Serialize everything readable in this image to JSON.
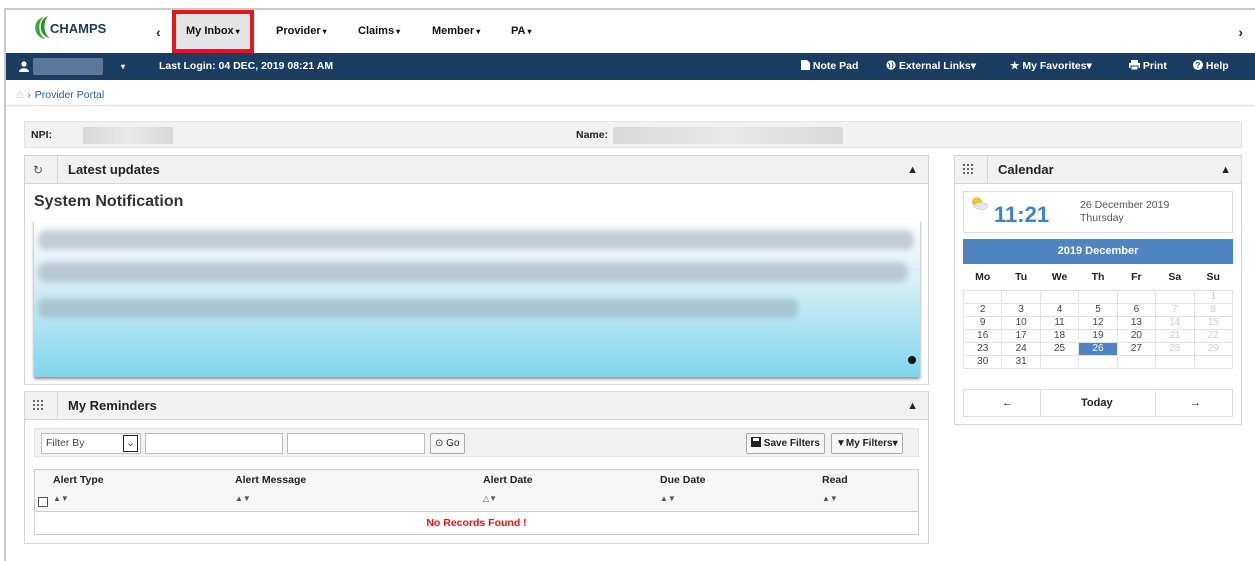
{
  "nav": {
    "logo_text": "CHAMPS",
    "left_arrow": "‹",
    "right_arrow": "›",
    "items": [
      {
        "label": "My Inbox",
        "caret": "▾"
      },
      {
        "label": "Provider",
        "caret": "▾"
      },
      {
        "label": "Claims",
        "caret": "▾"
      },
      {
        "label": "Member",
        "caret": "▾"
      },
      {
        "label": "PA",
        "caret": "▾"
      }
    ]
  },
  "toolbar": {
    "last_login": "Last Login: 04 DEC, 2019 08:21 AM",
    "note_pad": "Note Pad",
    "external_links": "External Links",
    "my_favorites": "My Favorites",
    "print": "Print",
    "help": "Help",
    "caret": "▾"
  },
  "breadcrumb": {
    "current": "Provider Portal"
  },
  "info": {
    "npi_label": "NPI:",
    "name_label": "Name:"
  },
  "updates": {
    "title": "Latest updates",
    "notification_title": "System Notification"
  },
  "reminders": {
    "title": "My Reminders",
    "filter_placeholder": "Filter By",
    "go_label": "Go",
    "save_filters": "Save Filters",
    "my_filters": "My Filters",
    "columns": [
      "Alert Type",
      "Alert Message",
      "Alert Date",
      "Due Date",
      "Read"
    ],
    "sort_glyph": "▲▼",
    "sort_glyph_alt": "△▼",
    "no_records": "No Records Found !"
  },
  "calendar": {
    "title": "Calendar",
    "time": "11:21",
    "date": "26 December 2019",
    "weekday": "Thursday",
    "month_label": "2019 December",
    "day_headers": [
      "Mo",
      "Tu",
      "We",
      "Th",
      "Fr",
      "Sa",
      "Su"
    ],
    "weeks": [
      [
        "",
        "",
        "",
        "",
        "",
        "",
        "1"
      ],
      [
        "2",
        "3",
        "4",
        "5",
        "6",
        "7",
        "8"
      ],
      [
        "9",
        "10",
        "11",
        "12",
        "13",
        "14",
        "15"
      ],
      [
        "16",
        "17",
        "18",
        "19",
        "20",
        "21",
        "22"
      ],
      [
        "23",
        "24",
        "25",
        "26",
        "27",
        "28",
        "29"
      ],
      [
        "30",
        "31",
        "",
        "",
        "",
        "",
        ""
      ]
    ],
    "today": "26",
    "today_label": "Today",
    "prev_icon": "←",
    "next_icon": "→"
  },
  "colors": {
    "toolbar_bg": "#1b3d63",
    "accent_blue": "#4f84c1",
    "highlight_red": "#e3161c",
    "logo_green": "#3aa83a"
  }
}
